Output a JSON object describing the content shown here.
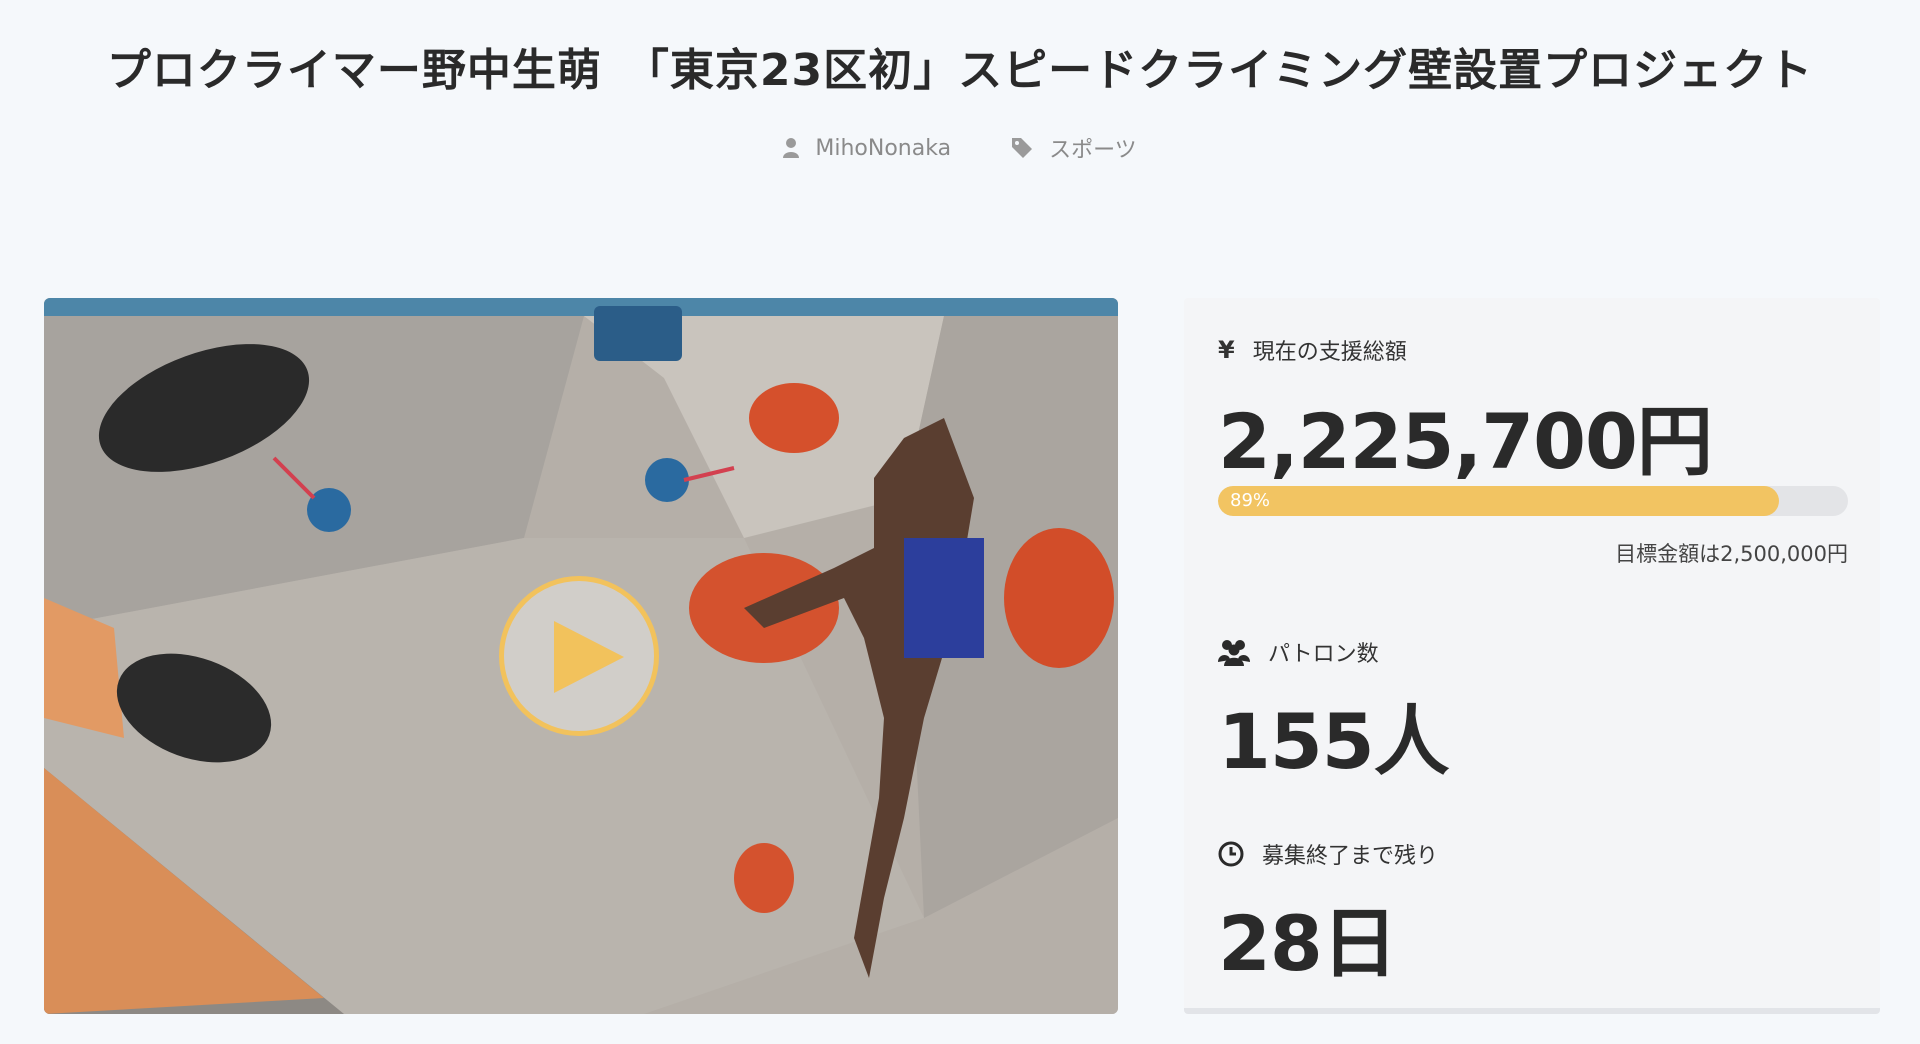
{
  "page": {
    "title": "プロクライマー野中生萌　「東京23区初」スピードクライミング壁設置プロジェクト",
    "author": "MihoNonaka",
    "category": "スポーツ"
  },
  "video": {
    "play_label": "Play"
  },
  "stats": {
    "total": {
      "icon": "yen-icon",
      "label": "現在の支援総額",
      "value": "2,225,700円"
    },
    "progress": {
      "percent": 89,
      "label": "89%",
      "goal_text": "目標金額は2,500,000円"
    },
    "patrons": {
      "icon": "users-icon",
      "label": "パトロン数",
      "value": "155人"
    },
    "remaining": {
      "icon": "clock-icon",
      "label": "募集終了まで残り",
      "value": "28日"
    }
  },
  "colors": {
    "accent": "#f2c462",
    "background": "#f5f8fb"
  }
}
